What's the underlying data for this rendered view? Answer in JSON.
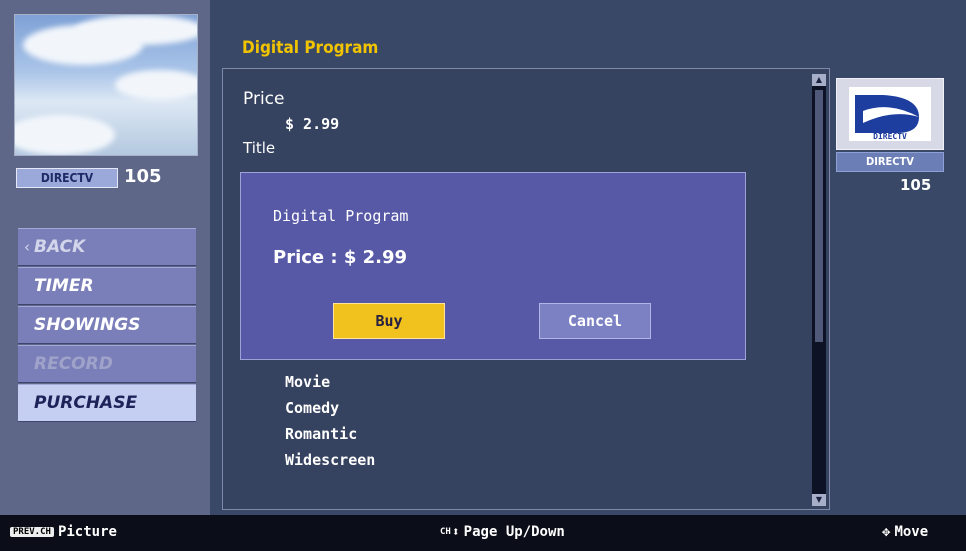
{
  "preview": {
    "channel_badge": "DIRECTV",
    "channel_number": "105"
  },
  "menu": {
    "back": "BACK",
    "timer": "TIMER",
    "showings": "SHOWINGS",
    "record": "RECORD",
    "purchase": "PURCHASE"
  },
  "section_title": "Digital Program",
  "details": {
    "price_label": "Price",
    "price_value": "$ 2.99",
    "title_label": "Title",
    "category_items": [
      "Movie",
      "Comedy",
      "Romantic",
      "Widescreen"
    ]
  },
  "logo": {
    "wordmark": "DIRECTV",
    "badge": "DIRECTV",
    "channel_number": "105"
  },
  "dialog": {
    "title": "Digital Program",
    "price": "Price : $ 2.99",
    "buy_label": "Buy",
    "cancel_label": "Cancel"
  },
  "footer": {
    "key_prev_ch": "PREV.CH",
    "picture_label": "Picture",
    "key_ch": "CH",
    "page_label": "Page Up/Down",
    "move_label": "Move"
  },
  "colors": {
    "accent_yellow": "#f2c400",
    "dialog_bg": "#5759a7",
    "menu_bg": "#7b7fb9",
    "menu_selected": "#c4cff2",
    "content_bg": "#354260"
  },
  "scroll": {
    "position_fraction": 0.0,
    "visible_fraction": 0.58
  }
}
